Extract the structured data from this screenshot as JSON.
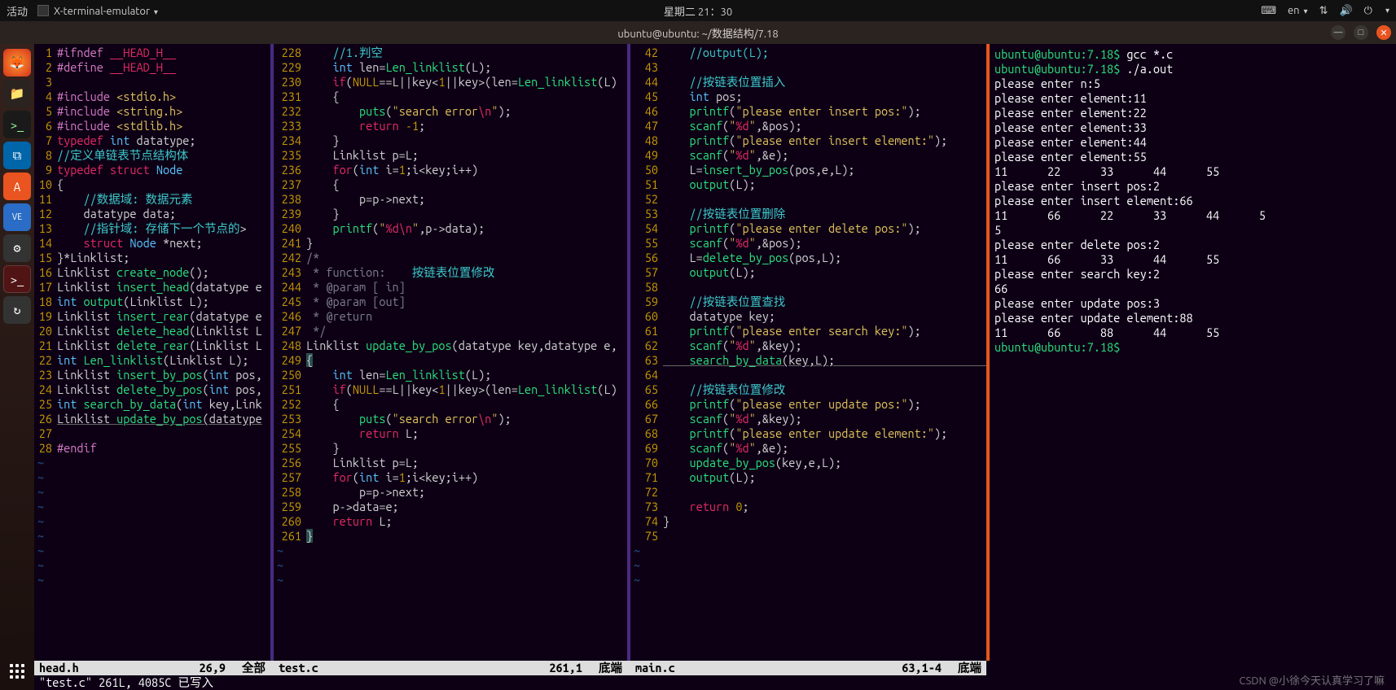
{
  "topbar": {
    "activities": "活动",
    "app": "X-terminal-emulator",
    "datetime": "星期二 21：30",
    "lang": "en"
  },
  "window": {
    "title": "ubuntu@ubuntu: ~/数据结构/7.18"
  },
  "dock": {
    "tooltip": "软件更新器"
  },
  "watermark": "CSDN @小徐今天认真学习了嘛",
  "pane1": {
    "status": {
      "file": "head.h",
      "pos": "26,9",
      "pct": "全部"
    },
    "lines": [
      {
        "n": 1,
        "h": "<span class='c-pre'>#ifndef</span> <span class='c-red'>__HEAD_H__</span>"
      },
      {
        "n": 2,
        "h": "<span class='c-pre'>#define</span> <span class='c-red'>__HEAD_H__</span>"
      },
      {
        "n": 3,
        "h": ""
      },
      {
        "n": 4,
        "h": "<span class='c-pre'>#include</span> <span class='c-str'>&lt;stdio.h&gt;</span>"
      },
      {
        "n": 5,
        "h": "<span class='c-pre'>#include</span> <span class='c-str'>&lt;string.h&gt;</span>"
      },
      {
        "n": 6,
        "h": "<span class='c-pre'>#include</span> <span class='c-str'>&lt;stdlib.h&gt;</span>"
      },
      {
        "n": 7,
        "h": "<span class='c-kw'>typedef</span> <span class='c-type'>int</span> datatype;"
      },
      {
        "n": 8,
        "h": "<span class='c-cmt2'>//定义单链表节点结构体</span>"
      },
      {
        "n": 9,
        "h": "<span class='c-kw'>typedef</span> <span class='c-kw'>struct</span> <span class='c-type'>Node</span>"
      },
      {
        "n": 10,
        "h": "{"
      },
      {
        "n": 11,
        "h": "    <span class='c-cmt2'>//数据域: 数据元素</span>"
      },
      {
        "n": 12,
        "h": "    datatype data;"
      },
      {
        "n": 13,
        "h": "    <span class='c-cmt2'>//指针域: 存储下一个节点的</span>&gt;"
      },
      {
        "n": 14,
        "h": "    <span class='c-kw'>struct</span> <span class='c-type'>Node</span> *next;"
      },
      {
        "n": 15,
        "h": "}*Linklist;"
      },
      {
        "n": 16,
        "h": "Linklist <span class='c-fn'>create_node</span>();"
      },
      {
        "n": 17,
        "h": "Linklist <span class='c-fn'>insert_head</span>(datatype e"
      },
      {
        "n": 18,
        "h": "<span class='c-type'>int</span> <span class='c-fn'>output</span>(Linklist L);"
      },
      {
        "n": 19,
        "h": "Linklist <span class='c-fn'>insert_rear</span>(datatype e"
      },
      {
        "n": 20,
        "h": "Linklist <span class='c-fn'>delete_head</span>(Linklist L"
      },
      {
        "n": 21,
        "h": "Linklist <span class='c-fn'>delete_rear</span>(Linklist L"
      },
      {
        "n": 22,
        "h": "<span class='c-type'>int</span> <span class='c-fn'>Len_linklist</span>(Linklist L);"
      },
      {
        "n": 23,
        "h": "Linklist <span class='c-fn'>insert_by_pos</span>(<span class='c-type'>int</span> pos,"
      },
      {
        "n": 24,
        "h": "Linklist <span class='c-fn'>delete_by_pos</span>(<span class='c-type'>int</span> pos,"
      },
      {
        "n": 25,
        "h": "<span class='c-type'>int</span> <span class='c-fn'>search_by_data</span>(<span class='c-type'>int</span> key,Link"
      },
      {
        "n": 26,
        "h": "<span class='underlined'>Linklist <span class='c-fn'>update_by_pos</span>(datatype</span>"
      },
      {
        "n": 27,
        "h": ""
      },
      {
        "n": 28,
        "h": "<span class='c-pre'>#endif</span>"
      }
    ]
  },
  "pane2": {
    "status": {
      "file": "test.c",
      "pos": "261,1",
      "pct": "底端"
    },
    "lines": [
      {
        "n": 228,
        "h": "    <span class='c-cmt2'>//1.判空</span>"
      },
      {
        "n": 229,
        "h": "    <span class='c-type'>int</span> len=<span class='c-fn'>Len_linklist</span>(L);"
      },
      {
        "n": 230,
        "h": "    <span class='c-kw'>if</span>(<span class='c-num'>NULL</span>==L||key&lt;<span class='c-num'>1</span>||key&gt;(len=<span class='c-fn'>Len_linklist</span>(L)"
      },
      {
        "n": 231,
        "h": "    {"
      },
      {
        "n": 232,
        "h": "        <span class='c-fn'>puts</span>(<span class='c-str'>\"search error</span><span class='c-red'>\\n</span><span class='c-str'>\"</span>);"
      },
      {
        "n": 233,
        "h": "        <span class='c-kw'>return</span> <span class='c-num'>-1</span>;"
      },
      {
        "n": 234,
        "h": "    }"
      },
      {
        "n": 235,
        "h": "    Linklist p=L;"
      },
      {
        "n": 236,
        "h": "    <span class='c-kw'>for</span>(<span class='c-type'>int</span> i=<span class='c-num'>1</span>;i&lt;key;i++)"
      },
      {
        "n": 237,
        "h": "    {"
      },
      {
        "n": 238,
        "h": "        p=p-&gt;next;"
      },
      {
        "n": 239,
        "h": "    }"
      },
      {
        "n": 240,
        "h": "    <span class='c-fn'>printf</span>(<span class='c-str'>\"</span><span class='c-red'>%d\\n</span><span class='c-str'>\"</span>,p-&gt;data);"
      },
      {
        "n": 241,
        "h": "}"
      },
      {
        "n": 242,
        "h": "<span class='c-cmt'>/*</span>"
      },
      {
        "n": 243,
        "h": "<span class='c-cmt'> * function:    </span><span class='c-cmt2'>按链表位置修改</span>"
      },
      {
        "n": 244,
        "h": "<span class='c-cmt'> * @param [ in]</span>"
      },
      {
        "n": 245,
        "h": "<span class='c-cmt'> * @param [out]</span>"
      },
      {
        "n": 246,
        "h": "<span class='c-cmt'> * @return</span>"
      },
      {
        "n": 247,
        "h": "<span class='c-cmt'> */</span>"
      },
      {
        "n": 248,
        "h": "Linklist <span class='c-fn'>update_by_pos</span>(datatype key,datatype e,"
      },
      {
        "n": 249,
        "h": "<span class='hl'>{</span>"
      },
      {
        "n": 250,
        "h": "    <span class='c-type'>int</span> len=<span class='c-fn'>Len_linklist</span>(L);"
      },
      {
        "n": 251,
        "h": "    <span class='c-kw'>if</span>(<span class='c-num'>NULL</span>==L||key&lt;<span class='c-num'>1</span>||key&gt;(len=<span class='c-fn'>Len_linklist</span>(L)"
      },
      {
        "n": 252,
        "h": "    {"
      },
      {
        "n": 253,
        "h": "        <span class='c-fn'>puts</span>(<span class='c-str'>\"search error</span><span class='c-red'>\\n</span><span class='c-str'>\"</span>);"
      },
      {
        "n": 254,
        "h": "        <span class='c-kw'>return</span> L;"
      },
      {
        "n": 255,
        "h": "    }"
      },
      {
        "n": 256,
        "h": "    Linklist p=L;"
      },
      {
        "n": 257,
        "h": "    <span class='c-kw'>for</span>(<span class='c-type'>int</span> i=<span class='c-num'>1</span>;i&lt;key;i++)"
      },
      {
        "n": 258,
        "h": "        p=p-&gt;next;"
      },
      {
        "n": 259,
        "h": "    p-&gt;data=e;"
      },
      {
        "n": 260,
        "h": "    <span class='c-kw'>return</span> L;"
      },
      {
        "n": 261,
        "h": "<span class='hl'>}</span>"
      }
    ]
  },
  "pane3": {
    "status": {
      "file": "main.c",
      "pos": "63,1-4",
      "pct": "底端"
    },
    "lines": [
      {
        "n": 42,
        "h": "    <span class='c-cmt2'>//output(L);</span>"
      },
      {
        "n": 43,
        "h": ""
      },
      {
        "n": 44,
        "h": "    <span class='c-cmt2'>//按链表位置插入</span>"
      },
      {
        "n": 45,
        "h": "    <span class='c-type'>int</span> pos;"
      },
      {
        "n": 46,
        "h": "    <span class='c-fn'>printf</span>(<span class='c-str'>\"please enter insert pos:\"</span>);"
      },
      {
        "n": 47,
        "h": "    <span class='c-fn'>scanf</span>(<span class='c-str'>\"</span><span class='c-red'>%d</span><span class='c-str'>\"</span>,&amp;pos);"
      },
      {
        "n": 48,
        "h": "    <span class='c-fn'>printf</span>(<span class='c-str'>\"please enter insert element:\"</span>);"
      },
      {
        "n": 49,
        "h": "    <span class='c-fn'>scanf</span>(<span class='c-str'>\"</span><span class='c-red'>%d</span><span class='c-str'>\"</span>,&amp;e);"
      },
      {
        "n": 50,
        "h": "    L=<span class='c-fn'>insert_by_pos</span>(pos,e,L);"
      },
      {
        "n": 51,
        "h": "    <span class='c-fn'>output</span>(L);"
      },
      {
        "n": 52,
        "h": ""
      },
      {
        "n": 53,
        "h": "    <span class='c-cmt2'>//按链表位置删除</span>"
      },
      {
        "n": 54,
        "h": "    <span class='c-fn'>printf</span>(<span class='c-str'>\"please enter delete pos:\"</span>);"
      },
      {
        "n": 55,
        "h": "    <span class='c-fn'>scanf</span>(<span class='c-str'>\"</span><span class='c-red'>%d</span><span class='c-str'>\"</span>,&amp;pos);"
      },
      {
        "n": 56,
        "h": "    L=<span class='c-fn'>delete_by_pos</span>(pos,L);"
      },
      {
        "n": 57,
        "h": "    <span class='c-fn'>output</span>(L);"
      },
      {
        "n": 58,
        "h": ""
      },
      {
        "n": 59,
        "h": "    <span class='c-cmt2'>//按链表位置查找</span>"
      },
      {
        "n": 60,
        "h": "    datatype key;"
      },
      {
        "n": 61,
        "h": "    <span class='c-fn'>printf</span>(<span class='c-str'>\"please enter search key:\"</span>);"
      },
      {
        "n": 62,
        "h": "    <span class='c-fn'>scanf</span>(<span class='c-str'>\"</span><span class='c-red'>%d</span><span class='c-str'>\"</span>,&amp;key);"
      },
      {
        "n": 63,
        "h": "<span class='underlined'>    <span class='c-fn'>search_by_data</span>(key,L);                       </span>"
      },
      {
        "n": 64,
        "h": ""
      },
      {
        "n": 65,
        "h": "    <span class='c-cmt2'>//按链表位置修改</span>"
      },
      {
        "n": 66,
        "h": "    <span class='c-fn'>printf</span>(<span class='c-str'>\"please enter update pos:\"</span>);"
      },
      {
        "n": 67,
        "h": "    <span class='c-fn'>scanf</span>(<span class='c-str'>\"</span><span class='c-red'>%d</span><span class='c-str'>\"</span>,&amp;key);"
      },
      {
        "n": 68,
        "h": "    <span class='c-fn'>printf</span>(<span class='c-str'>\"please enter update element:\"</span>);"
      },
      {
        "n": 69,
        "h": "    <span class='c-fn'>scanf</span>(<span class='c-str'>\"</span><span class='c-red'>%d</span><span class='c-str'>\"</span>,&amp;e);"
      },
      {
        "n": 70,
        "h": "    <span class='c-fn'>update_by_pos</span>(key,e,L);"
      },
      {
        "n": 71,
        "h": "    <span class='c-fn'>output</span>(L);"
      },
      {
        "n": 72,
        "h": ""
      },
      {
        "n": 73,
        "h": "    <span class='c-kw'>return</span> <span class='c-num'>0</span>;"
      },
      {
        "n": 74,
        "h": "}"
      },
      {
        "n": 75,
        "h": ""
      }
    ]
  },
  "msg": "\"test.c\" 261L, 4085C 已写入",
  "termout": [
    {
      "p": "ubuntu@ubuntu:7.18$",
      "c": "gcc *.c"
    },
    {
      "p": "ubuntu@ubuntu:7.18$",
      "c": "./a.out"
    },
    {
      "t": "please enter n:5"
    },
    {
      "t": "please enter element:11"
    },
    {
      "t": "please enter element:22"
    },
    {
      "t": "please enter element:33"
    },
    {
      "t": "please enter element:44"
    },
    {
      "t": "please enter element:55"
    },
    {
      "t": "11      22      33      44      55"
    },
    {
      "t": "please enter insert pos:2"
    },
    {
      "t": "please enter insert element:66"
    },
    {
      "t": "11      66      22      33      44      5"
    },
    {
      "t": "5"
    },
    {
      "t": "please enter delete pos:2"
    },
    {
      "t": "11      66      33      44      55"
    },
    {
      "t": "please enter search key:2"
    },
    {
      "t": "66"
    },
    {
      "t": "please enter update pos:3"
    },
    {
      "t": "please enter update element:88"
    },
    {
      "t": "11      66      88      44      55"
    },
    {
      "p": "ubuntu@ubuntu:7.18$",
      "c": ""
    }
  ]
}
